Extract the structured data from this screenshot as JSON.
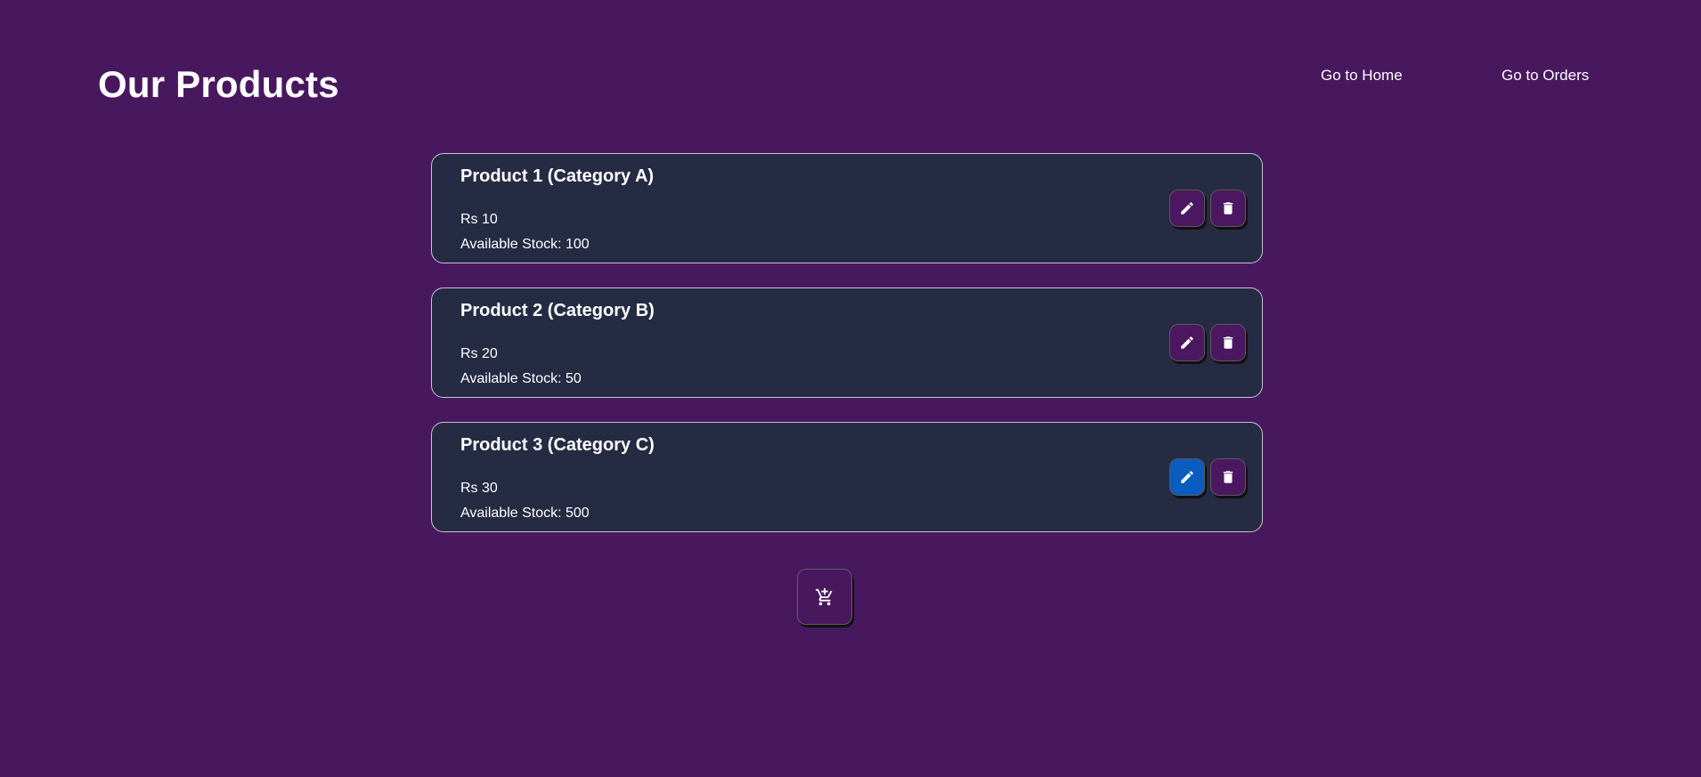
{
  "header": {
    "title": "Our Products",
    "nav": {
      "home": "Go to Home",
      "orders": "Go to Orders"
    }
  },
  "products": [
    {
      "title": "Product 1 (Category A)",
      "price": "Rs 10",
      "stock": "Available Stock: 100"
    },
    {
      "title": "Product 2 (Category B)",
      "price": "Rs 20",
      "stock": "Available Stock: 50"
    },
    {
      "title": "Product 3 (Category C)",
      "price": "Rs 30",
      "stock": "Available Stock: 500"
    }
  ],
  "icons": {
    "edit": "pencil-icon",
    "delete": "trash-icon",
    "cart": "cart-add-icon"
  },
  "colors": {
    "background": "#48185f",
    "card": "#262b44",
    "button": "#4a1760",
    "active_button": "#0a5cbf"
  }
}
